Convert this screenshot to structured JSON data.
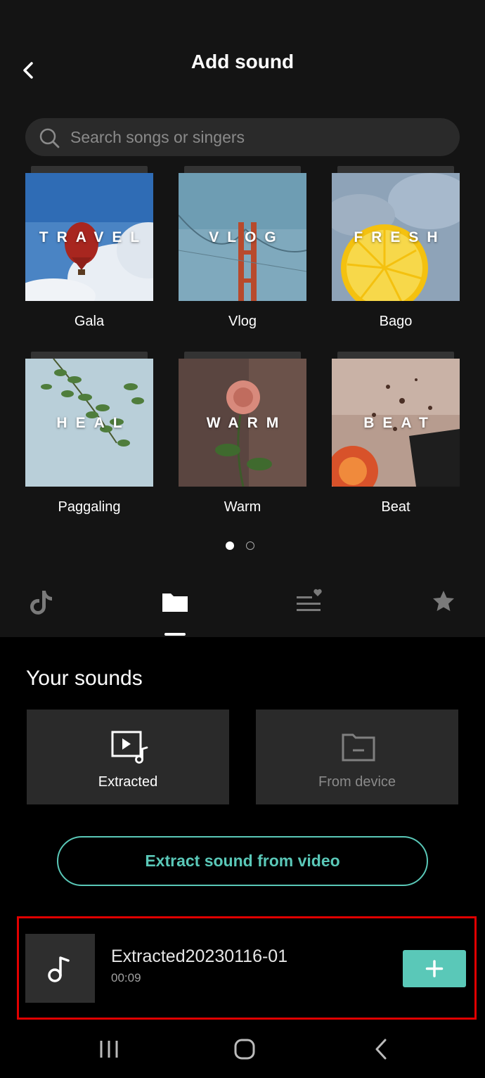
{
  "header": {
    "title": "Add sound",
    "back_icon": "chevron-left-icon"
  },
  "search": {
    "placeholder": "Search songs or singers",
    "value": "",
    "icon": "search-icon"
  },
  "categories": [
    {
      "name": "Gala",
      "thumb_label": "TRAVEL"
    },
    {
      "name": "Vlog",
      "thumb_label": "VLOG"
    },
    {
      "name": "Bago",
      "thumb_label": "FRESH"
    },
    {
      "name": "Paggaling",
      "thumb_label": "HEAL"
    },
    {
      "name": "Warm",
      "thumb_label": "WARM"
    },
    {
      "name": "Beat",
      "thumb_label": "BEAT"
    }
  ],
  "pagination": {
    "current": 1,
    "total": 2
  },
  "tabs": [
    {
      "icon": "tiktok-icon",
      "active": false
    },
    {
      "icon": "folder-icon",
      "active": true
    },
    {
      "icon": "playlist-heart-icon",
      "active": false
    },
    {
      "icon": "star-icon",
      "active": false
    }
  ],
  "your_sounds": {
    "title": "Your sounds",
    "sources": [
      {
        "label": "Extracted",
        "icon": "video-music-icon",
        "enabled": true
      },
      {
        "label": "From device",
        "icon": "folder-minus-icon",
        "enabled": false
      }
    ],
    "extract_button": "Extract sound from video"
  },
  "tracks": [
    {
      "title": "Extracted20230116-01",
      "duration": "00:09",
      "icon": "music-note-icon",
      "action_icon": "plus-icon"
    }
  ],
  "navbar": {
    "icons": [
      "recent-apps-icon",
      "home-icon",
      "back-icon"
    ]
  },
  "colors": {
    "accent": "#5ac8b8",
    "highlight": "#e00000",
    "panel": "#141414",
    "card": "#2a2a2a"
  }
}
